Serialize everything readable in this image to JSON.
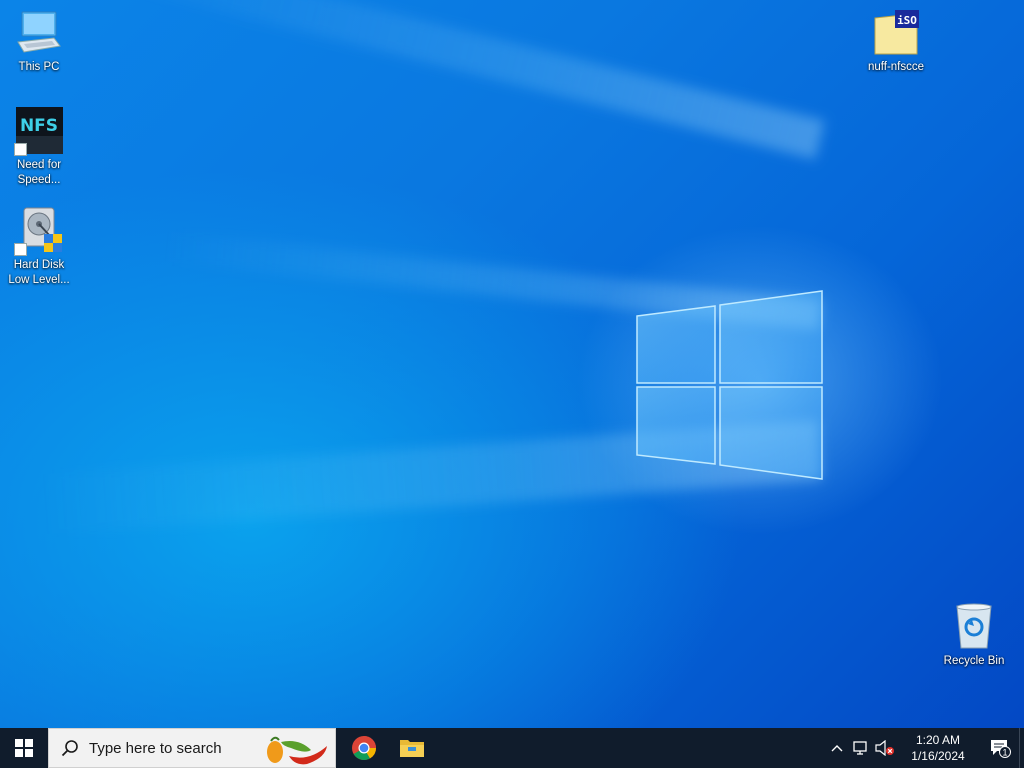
{
  "desktop": {
    "icons": [
      {
        "label": "This PC",
        "icon": "this-pc-icon"
      },
      {
        "label": "Need for\nSpeed...",
        "icon": "nfs-icon",
        "logo_text": "NFS"
      },
      {
        "label": "Hard Disk\nLow Level...",
        "icon": "hdd-tool-icon"
      },
      {
        "label": "nuff-nfscce",
        "icon": "iso-file-icon",
        "badge_text": "iSO"
      },
      {
        "label": "Recycle Bin",
        "icon": "recycle-bin-icon"
      }
    ]
  },
  "taskbar": {
    "search_placeholder": "Type here to search",
    "pinned_apps": [
      "chrome-icon",
      "file-explorer-icon"
    ],
    "tray": {
      "time": "1:20 AM",
      "date": "1/16/2024",
      "notification_count": "1"
    }
  },
  "colors": {
    "taskbar_bg": "#101c2c",
    "desktop_blue": "#0a78e0",
    "search_bg": "#f2f2f2"
  }
}
